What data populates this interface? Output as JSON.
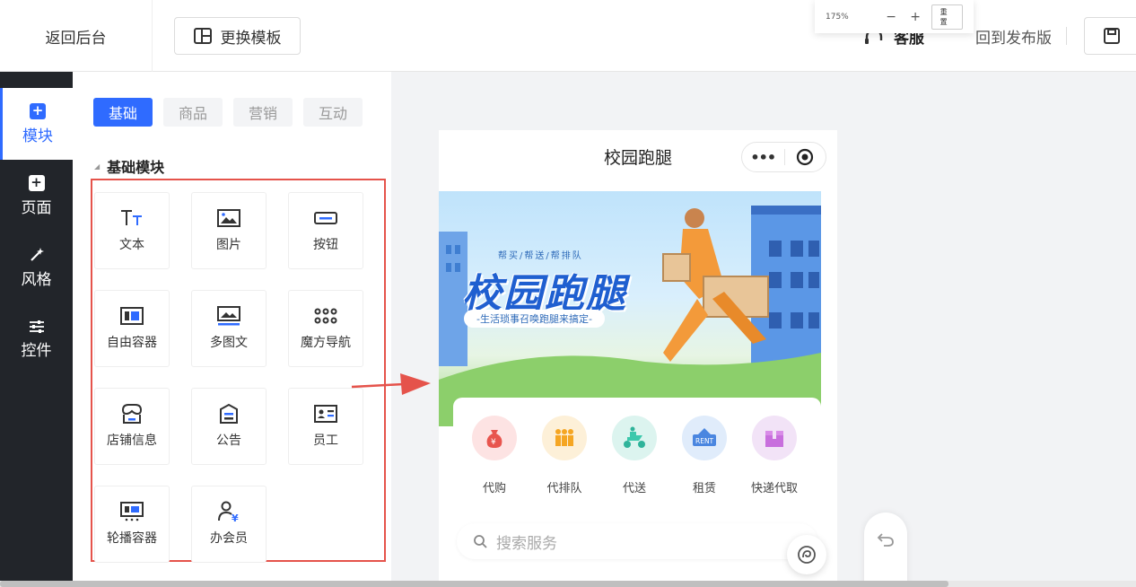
{
  "topbar": {
    "back_label": "返回后台",
    "swap_template_label": "更换模板",
    "zoom": {
      "percent": "175%",
      "minus": "−",
      "plus": "+",
      "reset_label": "重置"
    },
    "service_label": "客服",
    "revert_label": "回到发布版"
  },
  "sidebar": {
    "items": [
      {
        "label": "模块",
        "icon": "plus-square-icon",
        "active": true
      },
      {
        "label": "页面",
        "icon": "plus-square-icon",
        "active": false
      },
      {
        "label": "风格",
        "icon": "magic-wand-icon",
        "active": false
      },
      {
        "label": "控件",
        "icon": "sliders-icon",
        "active": false
      }
    ]
  },
  "panel": {
    "tabs": [
      "基础",
      "商品",
      "营销",
      "互动"
    ],
    "section_title": "基础模块",
    "modules": [
      {
        "label": "文本",
        "icon": "text-icon"
      },
      {
        "label": "图片",
        "icon": "image-icon"
      },
      {
        "label": "按钮",
        "icon": "button-icon"
      },
      {
        "label": "自由容器",
        "icon": "free-container-icon"
      },
      {
        "label": "多图文",
        "icon": "multi-image-text-icon"
      },
      {
        "label": "魔方导航",
        "icon": "grid-nav-icon"
      },
      {
        "label": "店铺信息",
        "icon": "store-icon"
      },
      {
        "label": "公告",
        "icon": "notice-icon"
      },
      {
        "label": "员工",
        "icon": "staff-card-icon"
      },
      {
        "label": "轮播容器",
        "icon": "carousel-icon"
      },
      {
        "label": "办会员",
        "icon": "member-icon"
      }
    ]
  },
  "phone": {
    "title": "校园跑腿",
    "banner": {
      "subtitle": "帮买/帮送/帮排队",
      "headline": "校园跑腿",
      "slogan": "-生活琐事召唤跑腿来搞定-"
    },
    "services": [
      {
        "label": "代购",
        "icon": "money-bag-icon",
        "color": "#fde3e3"
      },
      {
        "label": "代排队",
        "icon": "queue-people-icon",
        "color": "#fdf0d8"
      },
      {
        "label": "代送",
        "icon": "delivery-scooter-icon",
        "color": "#dcf4ef"
      },
      {
        "label": "租赁",
        "icon": "rent-sign-icon",
        "color": "#e0ecfb"
      },
      {
        "label": "快递代取",
        "icon": "parcel-icon",
        "color": "#f2e3f7"
      }
    ],
    "search_placeholder": "搜索服务"
  },
  "colors": {
    "accent": "#2f6bff",
    "highlight": "#e5534b",
    "sidebar_bg": "#22252a"
  }
}
